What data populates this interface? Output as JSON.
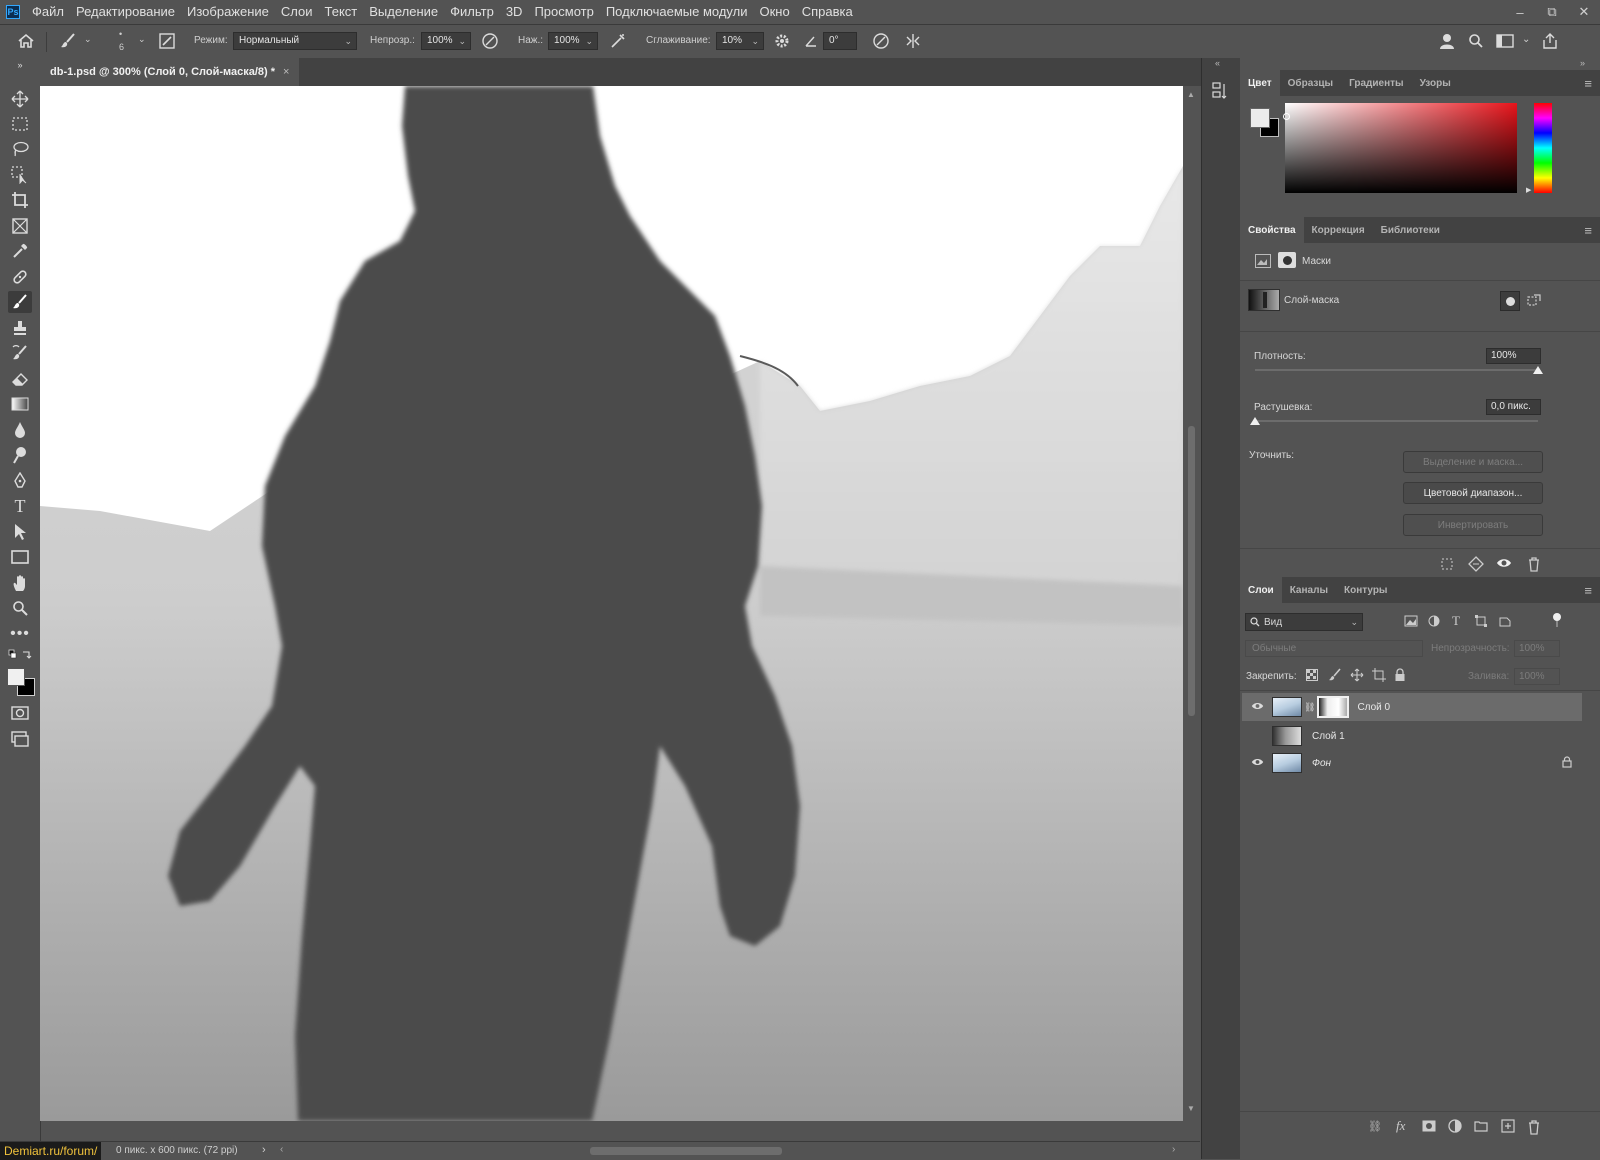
{
  "app": {
    "logo": "Ps"
  },
  "menu": [
    "Файл",
    "Редактирование",
    "Изображение",
    "Слои",
    "Текст",
    "Выделение",
    "Фильтр",
    "3D",
    "Просмотр",
    "Подключаемые модули",
    "Окно",
    "Справка"
  ],
  "window_controls": {
    "minimize": "–",
    "restore": "⧉",
    "close": "✕"
  },
  "options": {
    "brush_size": "6",
    "mode_label": "Режим:",
    "mode_value": "Нормальный",
    "opacity_label": "Непрозр.:",
    "opacity_value": "100%",
    "pressure_label": "Наж.:",
    "pressure_value": "100%",
    "smoothing_label": "Сглаживание:",
    "smoothing_value": "10%",
    "angle_value": "0°"
  },
  "document": {
    "tab_title": "db-1.psd @ 300% (Слой 0, Слой-маска/8) *",
    "close": "×"
  },
  "status": {
    "watermark": "Demiart.ru/forum/",
    "info": "0 пикс. x 600 пикс. (72 ppi)",
    "arrow": "›"
  },
  "color_panel": {
    "tabs": [
      "Цвет",
      "Образцы",
      "Градиенты",
      "Узоры"
    ]
  },
  "properties_panel": {
    "tabs": [
      "Свойства",
      "Коррекция",
      "Библиотеки"
    ],
    "masks_label": "Маски",
    "layer_mask_label": "Слой-маска",
    "density_label": "Плотность:",
    "density_value": "100%",
    "density_fraction": 1.0,
    "feather_label": "Растушевка:",
    "feather_value": "0,0 пикс.",
    "feather_fraction": 0.0,
    "refine_label": "Уточнить:",
    "select_mask_button": "Выделение и маска...",
    "color_range_button": "Цветовой диапазон...",
    "invert_button": "Инвертировать"
  },
  "layers_panel": {
    "tabs": [
      "Слои",
      "Каналы",
      "Контуры"
    ],
    "filter_value": "Вид",
    "blend_mode": "Обычные",
    "opacity_label": "Непрозрачность:",
    "opacity_value": "100%",
    "lock_label": "Закрепить:",
    "fill_label": "Заливка:",
    "fill_value": "100%",
    "layers": [
      {
        "name": "Слой 0",
        "visible": true,
        "selected": true,
        "has_mask": true
      },
      {
        "name": "Слой 1",
        "visible": false,
        "selected": false,
        "has_mask": false
      },
      {
        "name": "Фон",
        "visible": true,
        "selected": false,
        "has_mask": false,
        "locked": true
      }
    ]
  },
  "colors": {
    "ui_bg": "#535353",
    "panel_dark": "#424242",
    "accent_ps": "#31a8ff"
  }
}
